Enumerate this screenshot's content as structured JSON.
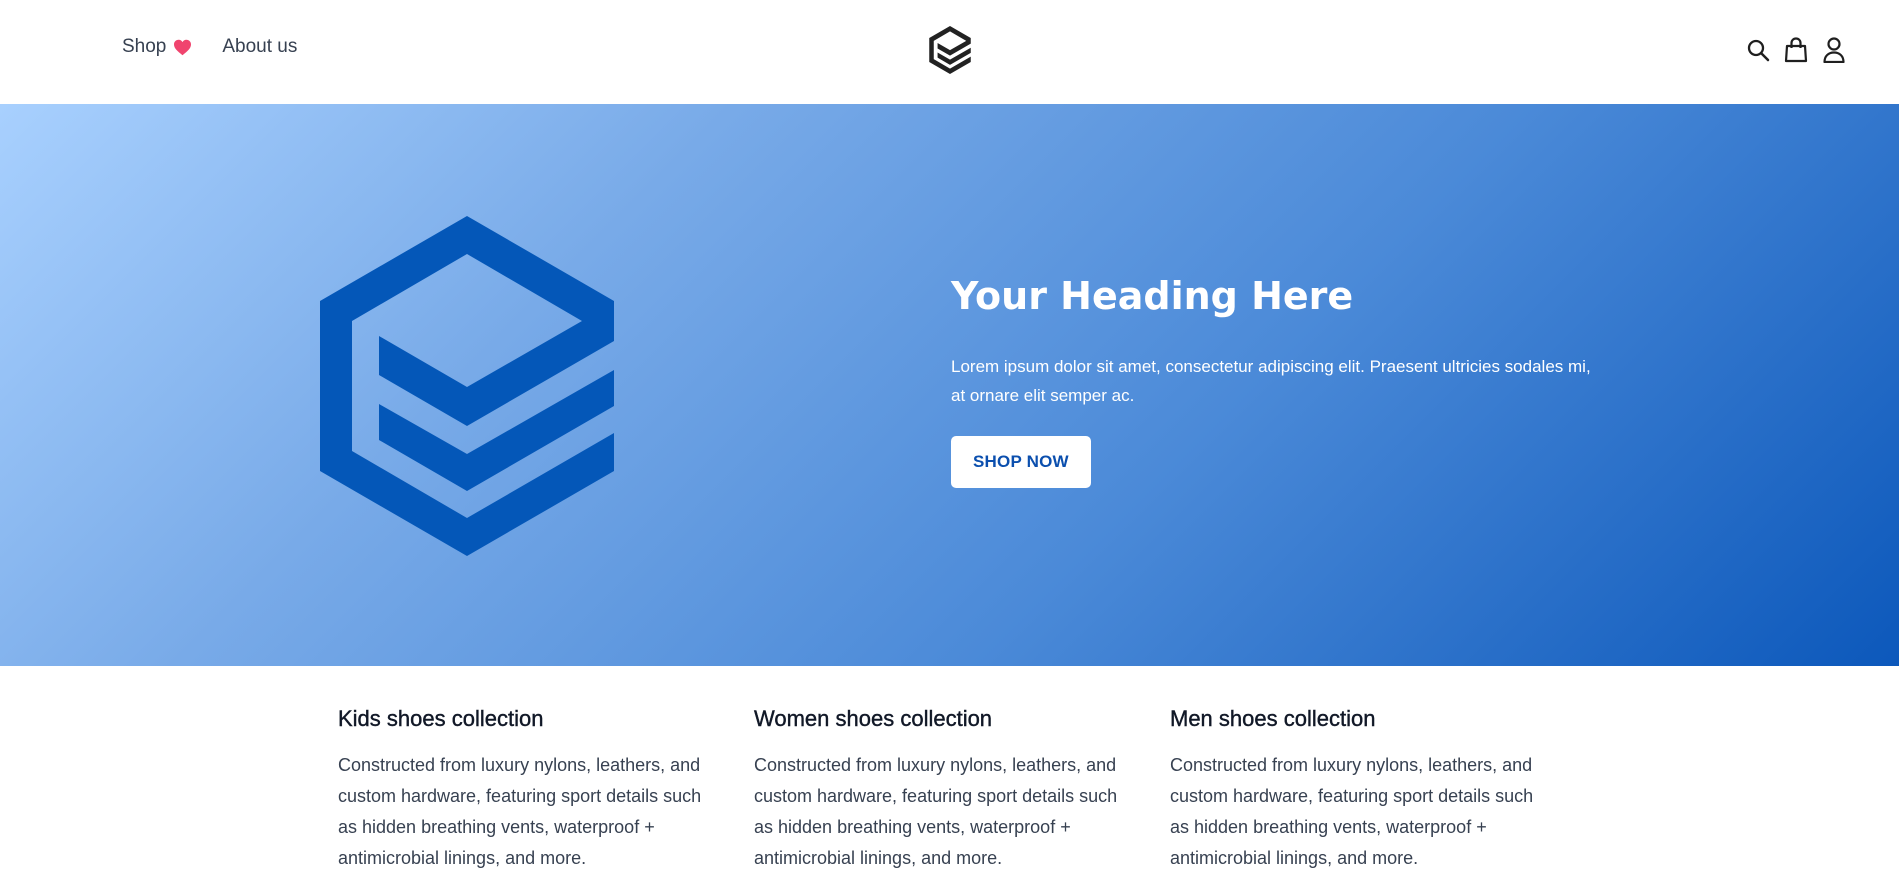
{
  "nav": {
    "shop_label": "Shop",
    "about_label": "About us"
  },
  "icons": {
    "heart": "heart-icon",
    "logo": "brand-logo",
    "search": "search-icon",
    "bag": "shopping-bag-icon",
    "user": "user-icon"
  },
  "colors": {
    "heart": "#f0446e",
    "hero_gradient_start": "#a8d0fe",
    "hero_gradient_end": "#0c58bb",
    "hero_logo": "#0457b8",
    "button_text": "#0b4fae"
  },
  "hero": {
    "heading": "Your Heading Here",
    "body": "Lorem ipsum dolor sit amet, consectetur adipiscing elit. Praesent ultricies sodales mi, at ornare elit semper ac.",
    "button_label": "SHOP NOW"
  },
  "collections": [
    {
      "title": "Kids shoes collection",
      "body": "Constructed from luxury nylons, leathers, and custom hardware, featuring sport details such as hidden breathing vents, waterproof + antimicrobial linings, and more."
    },
    {
      "title": "Women shoes collection",
      "body": "Constructed from luxury nylons, leathers, and custom hardware, featuring sport details such as hidden breathing vents, waterproof + antimicrobial linings, and more."
    },
    {
      "title": "Men shoes collection",
      "body": "Constructed from luxury nylons, leathers, and custom hardware, featuring sport details such as hidden breathing vents, waterproof + antimicrobial linings, and more."
    }
  ]
}
